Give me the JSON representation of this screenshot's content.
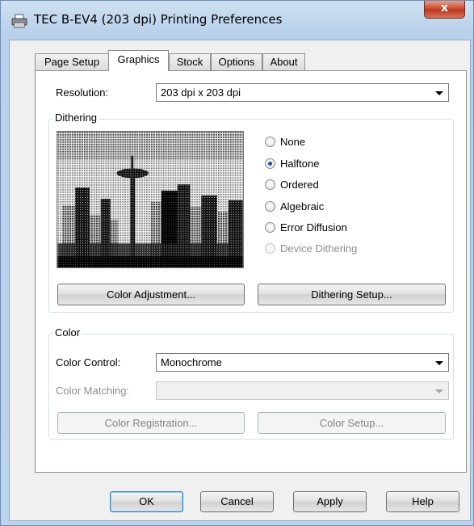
{
  "window": {
    "title": "TEC B-EV4 (203 dpi) Printing Preferences",
    "close_glyph": "x"
  },
  "tabs": [
    "Page Setup",
    "Graphics",
    "Stock",
    "Options",
    "About"
  ],
  "active_tab": "Graphics",
  "resolution": {
    "label": "Resolution:",
    "value": "203 dpi x 203 dpi"
  },
  "dithering": {
    "group_title": "Dithering",
    "options": [
      {
        "label": "None",
        "checked": false,
        "enabled": true
      },
      {
        "label": "Halftone",
        "checked": true,
        "enabled": true
      },
      {
        "label": "Ordered",
        "checked": false,
        "enabled": true
      },
      {
        "label": "Algebraic",
        "checked": false,
        "enabled": true
      },
      {
        "label": "Error Diffusion",
        "checked": false,
        "enabled": true
      },
      {
        "label": "Device Dithering",
        "checked": false,
        "enabled": false
      }
    ],
    "color_adjustment_button": "Color Adjustment...",
    "dithering_setup_button": "Dithering Setup..."
  },
  "color": {
    "group_title": "Color",
    "control_label": "Color Control:",
    "control_value": "Monochrome",
    "matching_label": "Color Matching:",
    "matching_value": "",
    "registration_button": "Color Registration...",
    "setup_button": "Color Setup..."
  },
  "footer": {
    "ok": "OK",
    "cancel": "Cancel",
    "apply": "Apply",
    "help": "Help"
  },
  "icons": {
    "title": "printer-icon",
    "preview": "dithered-city-skyline-preview"
  }
}
